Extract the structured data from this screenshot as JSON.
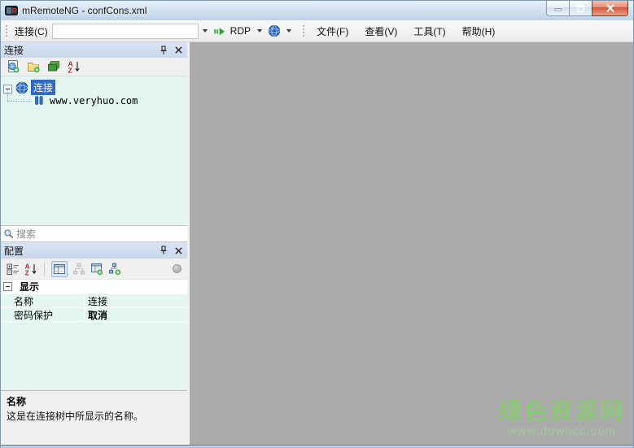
{
  "window": {
    "title": "mRemoteNG - confCons.xml"
  },
  "toolbar": {
    "connect_label": "连接(C)",
    "combo_value": "",
    "quick_connect_protocol": "RDP",
    "menus": [
      "文件(F)",
      "查看(V)",
      "工具(T)",
      "帮助(H)"
    ]
  },
  "connections_panel": {
    "title": "连接",
    "tree": {
      "root_label": "连接",
      "child_label": "www.veryhuo.com"
    },
    "search_placeholder": "搜索"
  },
  "config_panel": {
    "title": "配置",
    "category": "显示",
    "rows": [
      {
        "label": "名称",
        "value": "连接"
      },
      {
        "label": "密码保护",
        "value": "取消"
      }
    ],
    "description_title": "名称",
    "description_text": "这是在连接树中所显示的名称。"
  },
  "watermark": {
    "title": "绿色资源网",
    "url": "www.downcc.com"
  },
  "colors": {
    "titlebar_top": "#e7f0fa",
    "titlebar_mid": "#cfe0f0",
    "titlebar_bottom": "#bdd2e8",
    "panel_header_bg": "#d8e4f3",
    "tree_bg": "#e3f6f0",
    "selection": "#316ac5",
    "canvas_gray": "#ababab",
    "close_red": "#d35440",
    "watermark_green": "#8cc878",
    "watermark_url": "#a3c9a0"
  }
}
